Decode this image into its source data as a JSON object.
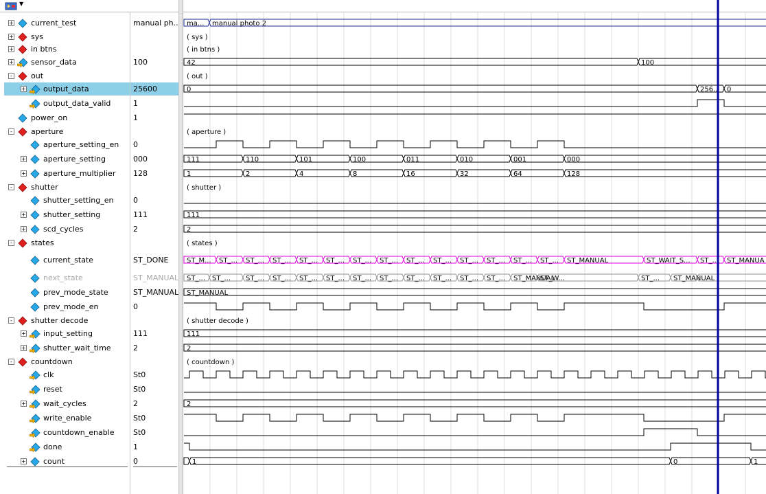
{
  "colors": {
    "selected_row": "#8ecfe8",
    "waveform": "#000000",
    "state_bus": "#e000e0",
    "test_bus": "#1a2a9a",
    "cursor": "#0000a0",
    "grid": "#dcdcdc"
  },
  "signals": [
    {
      "name": "current_test",
      "value": "manual ph...",
      "depth": 0,
      "expander": "+",
      "icon": "diamond-blue"
    },
    {
      "name": "sys",
      "value": "",
      "depth": 0,
      "expander": "+",
      "icon": "diamond-red"
    },
    {
      "name": "in btns",
      "value": "",
      "depth": 0,
      "expander": "+",
      "icon": "diamond-red"
    },
    {
      "name": "sensor_data",
      "value": "100",
      "depth": 0,
      "expander": "+",
      "icon": "diamond-arrow"
    },
    {
      "name": "out",
      "value": "",
      "depth": 0,
      "expander": "-",
      "icon": "diamond-red"
    },
    {
      "name": "output_data",
      "value": "25600",
      "depth": 1,
      "expander": "+",
      "icon": "diamond-arrow",
      "selected": true
    },
    {
      "name": "output_data_valid",
      "value": "1",
      "depth": 1,
      "expander": "",
      "icon": "diamond-arrow"
    },
    {
      "name": "power_on",
      "value": "1",
      "depth": 0,
      "expander": "",
      "icon": "diamond-blue"
    },
    {
      "name": "aperture",
      "value": "",
      "depth": 0,
      "expander": "-",
      "icon": "diamond-red"
    },
    {
      "name": "aperture_setting_en",
      "value": "0",
      "depth": 1,
      "expander": "",
      "icon": "diamond-blue"
    },
    {
      "name": "aperture_setting",
      "value": "000",
      "depth": 1,
      "expander": "+",
      "icon": "diamond-blue"
    },
    {
      "name": "aperture_multiplier",
      "value": "128",
      "depth": 1,
      "expander": "+",
      "icon": "diamond-blue"
    },
    {
      "name": "shutter",
      "value": "",
      "depth": 0,
      "expander": "-",
      "icon": "diamond-red"
    },
    {
      "name": "shutter_setting_en",
      "value": "0",
      "depth": 1,
      "expander": "",
      "icon": "diamond-blue"
    },
    {
      "name": "shutter_setting",
      "value": "111",
      "depth": 1,
      "expander": "+",
      "icon": "diamond-blue"
    },
    {
      "name": "scd_cycles",
      "value": "2",
      "depth": 1,
      "expander": "+",
      "icon": "diamond-blue"
    },
    {
      "name": "states",
      "value": "",
      "depth": 0,
      "expander": "-",
      "icon": "diamond-red"
    },
    {
      "name": "current_state",
      "value": "ST_DONE",
      "depth": 1,
      "expander": "",
      "icon": "diamond-blue",
      "tall": true
    },
    {
      "name": "next_state",
      "value": "ST_MANUAL",
      "depth": 1,
      "expander": "",
      "icon": "diamond-blue",
      "dim": true
    },
    {
      "name": "prev_mode_state",
      "value": "ST_MANUAL",
      "depth": 1,
      "expander": "",
      "icon": "diamond-blue"
    },
    {
      "name": "prev_mode_en",
      "value": "0",
      "depth": 1,
      "expander": "",
      "icon": "diamond-blue"
    },
    {
      "name": "shutter decode",
      "value": "",
      "depth": 0,
      "expander": "-",
      "icon": "diamond-red"
    },
    {
      "name": "input_setting",
      "value": "111",
      "depth": 1,
      "expander": "+",
      "icon": "diamond-arrow"
    },
    {
      "name": "shutter_wait_time",
      "value": "2",
      "depth": 1,
      "expander": "+",
      "icon": "diamond-arrow"
    },
    {
      "name": "countdown",
      "value": "",
      "depth": 0,
      "expander": "-",
      "icon": "diamond-red"
    },
    {
      "name": "clk",
      "value": "St0",
      "depth": 1,
      "expander": "",
      "icon": "diamond-arrow"
    },
    {
      "name": "reset",
      "value": "St0",
      "depth": 1,
      "expander": "",
      "icon": "diamond-arrow"
    },
    {
      "name": "wait_cycles",
      "value": "2",
      "depth": 1,
      "expander": "+",
      "icon": "diamond-arrow"
    },
    {
      "name": "write_enable",
      "value": "St0",
      "depth": 1,
      "expander": "",
      "icon": "diamond-arrow"
    },
    {
      "name": "countdown_enable",
      "value": "St0",
      "depth": 1,
      "expander": "",
      "icon": "diamond-arrow"
    },
    {
      "name": "done",
      "value": "1",
      "depth": 1,
      "expander": "",
      "icon": "diamond-arrow"
    },
    {
      "name": "count",
      "value": "0",
      "depth": 1,
      "expander": "+",
      "icon": "diamond-blue"
    }
  ],
  "group_labels": {
    "sys": "( sys )",
    "in_btns": "( in btns )",
    "out": "( out )",
    "aperture": "( aperture )",
    "shutter": "( shutter )",
    "states": "( states )",
    "shutter_decode": "( shutter decode )",
    "countdown": "( countdown )"
  },
  "bus_labels": {
    "current_test": [
      "ma...",
      "manual photo 2"
    ],
    "sensor_data": [
      "42",
      "100"
    ],
    "output_data": [
      "0",
      "256...",
      "0"
    ],
    "aperture_setting": [
      "111",
      "110",
      "101",
      "100",
      "011",
      "010",
      "001",
      "000"
    ],
    "aperture_multiplier": [
      "1",
      "2",
      "4",
      "8",
      "16",
      "32",
      "64",
      "128"
    ],
    "shutter_setting": [
      "111"
    ],
    "scd_cycles": [
      "2"
    ],
    "current_state": [
      "ST_M...",
      "ST_...",
      "ST_...",
      "ST_...",
      "ST_...",
      "ST_...",
      "ST_...",
      "ST_...",
      "ST_...",
      "ST_...",
      "ST_...",
      "ST_...",
      "ST_...",
      "ST_...",
      "ST_MANUAL",
      "ST_WAIT_S...",
      "ST_...",
      "ST_MANUA"
    ],
    "next_state": [
      "ST_...",
      "ST_...",
      "ST_...",
      "ST_...",
      "ST_...",
      "ST_...",
      "ST_...",
      "ST_...",
      "ST_...",
      "ST_...",
      "ST_...",
      "ST_...",
      "ST_MANUAL",
      "ST_W...",
      "ST_...",
      "ST_MANUAL"
    ],
    "prev_mode_state": [
      "ST_MANUAL"
    ],
    "input_setting": [
      "111"
    ],
    "shutter_wait_time": [
      "2"
    ],
    "wait_cycles": [
      "2"
    ],
    "count": [
      "1",
      "0",
      "1"
    ]
  }
}
